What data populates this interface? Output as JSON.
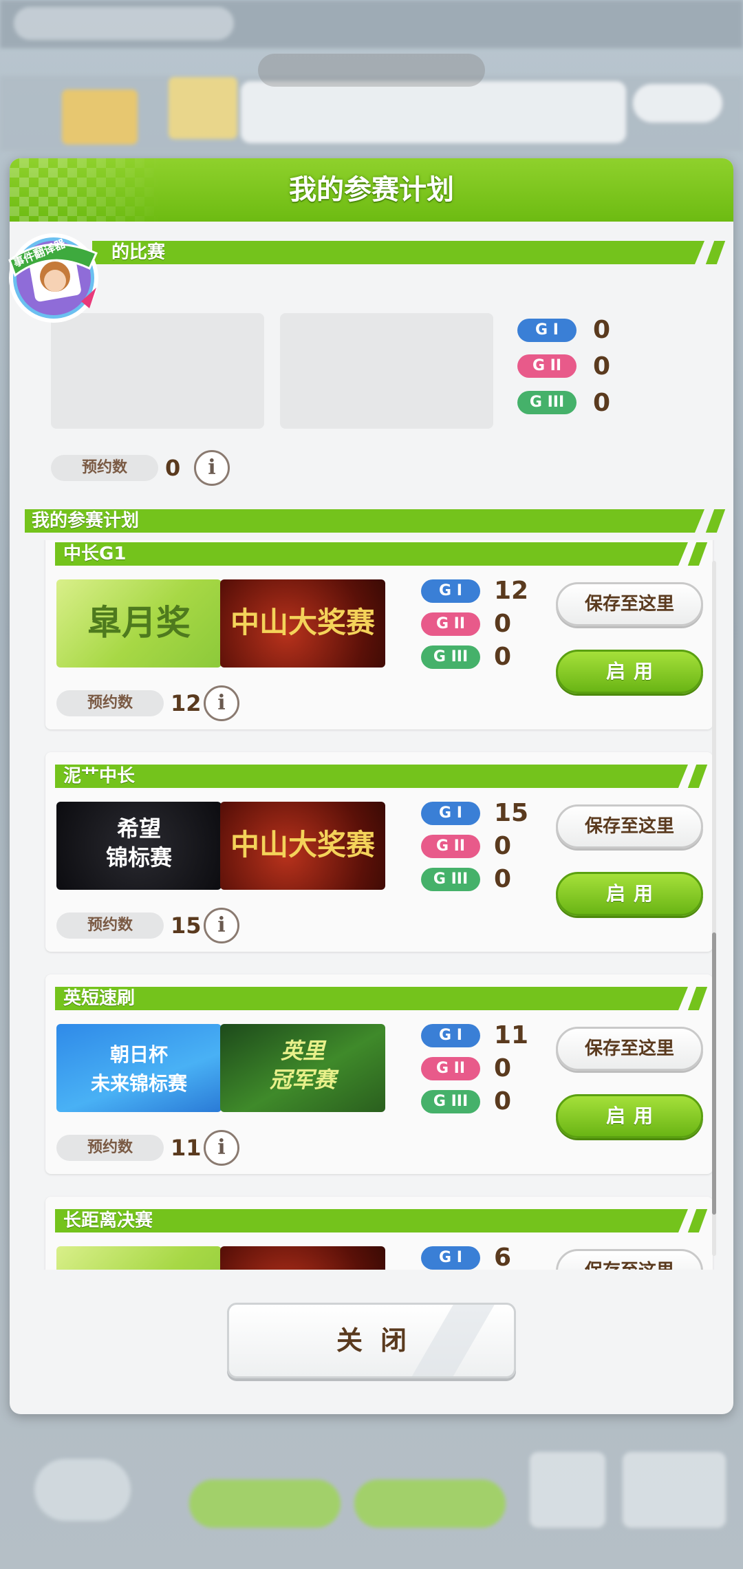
{
  "dialog": {
    "title": "我的参赛计划",
    "current_section_label": "的比赛",
    "current_grades": [
      {
        "grade": "G I",
        "count": "0"
      },
      {
        "grade": "G II",
        "count": "0"
      },
      {
        "grade": "G III",
        "count": "0"
      }
    ],
    "reserve_label": "预约数",
    "current_reserve_count": "0",
    "plans_section_label": "我的参赛计划",
    "info_icon_glyph": "i",
    "save_label": "保存至这里",
    "use_label": "启用",
    "close_label": "关闭"
  },
  "translate_badge": {
    "label": "事件翻译器"
  },
  "plans": [
    {
      "name": "中长G1",
      "races": [
        {
          "title": "皐月奖",
          "style": "green"
        },
        {
          "title": "中山大奖赛",
          "style": "red"
        }
      ],
      "grades": [
        {
          "grade": "G I",
          "count": "12"
        },
        {
          "grade": "G II",
          "count": "0"
        },
        {
          "grade": "G III",
          "count": "0"
        }
      ],
      "reserve_count": "12"
    },
    {
      "name": "泥艹中长",
      "races": [
        {
          "title": "希望\n锦标赛",
          "style": "dark"
        },
        {
          "title": "中山大奖赛",
          "style": "red"
        }
      ],
      "grades": [
        {
          "grade": "G I",
          "count": "15"
        },
        {
          "grade": "G II",
          "count": "0"
        },
        {
          "grade": "G III",
          "count": "0"
        }
      ],
      "reserve_count": "15"
    },
    {
      "name": "英短速刷",
      "races": [
        {
          "title": "朝日杯\n未来锦标赛",
          "style": "blue"
        },
        {
          "title": "英里\n冠军赛",
          "style": "grass"
        }
      ],
      "grades": [
        {
          "grade": "G I",
          "count": "11"
        },
        {
          "grade": "G II",
          "count": "0"
        },
        {
          "grade": "G III",
          "count": "0"
        }
      ],
      "reserve_count": "11"
    },
    {
      "name": "长距离决赛",
      "races": [
        {
          "title": "",
          "style": "green"
        },
        {
          "title": "",
          "style": "red"
        }
      ],
      "grades": [
        {
          "grade": "G I",
          "count": "6"
        }
      ],
      "reserve_count": ""
    }
  ],
  "colors": {
    "header_green": "#74c31c",
    "g1_blue": "#3a7fd6",
    "g2_pink": "#e85a8a",
    "g3_green": "#45b16a",
    "text_brown": "#5a3a1e"
  }
}
